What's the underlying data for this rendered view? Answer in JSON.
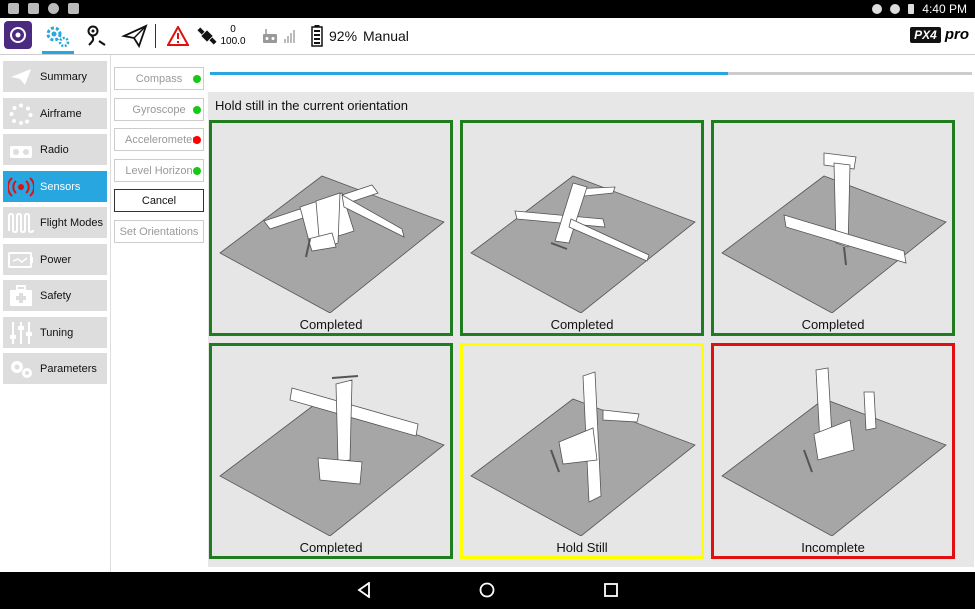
{
  "statusbar": {
    "time": "4:40 PM"
  },
  "toolbar": {
    "gps_count": "0",
    "gps_hdop": "100.0",
    "battery": "92%",
    "flight_mode": "Manual",
    "brand_badge": "PX4",
    "brand_text": "pro"
  },
  "sidebar": {
    "items": [
      {
        "label": "Summary"
      },
      {
        "label": "Airframe"
      },
      {
        "label": "Radio"
      },
      {
        "label": "Sensors"
      },
      {
        "label": "Flight Modes"
      },
      {
        "label": "Power"
      },
      {
        "label": "Safety"
      },
      {
        "label": "Tuning"
      },
      {
        "label": "Parameters"
      }
    ],
    "active_index": 3
  },
  "sensor_buttons": [
    {
      "label": "Compass",
      "status": "ok"
    },
    {
      "label": "Gyroscope",
      "status": "ok"
    },
    {
      "label": "Accelerometer",
      "status": "error"
    },
    {
      "label": "Level Horizon",
      "status": "ok"
    }
  ],
  "actions": {
    "cancel": "Cancel",
    "set_orientations": "Set Orientations"
  },
  "calibration": {
    "progress": 0.68,
    "instruction": "Hold still in the current orientation",
    "tiles": [
      {
        "label": "Completed",
        "state": "completed"
      },
      {
        "label": "Completed",
        "state": "completed"
      },
      {
        "label": "Completed",
        "state": "completed"
      },
      {
        "label": "Completed",
        "state": "completed"
      },
      {
        "label": "Hold Still",
        "state": "active"
      },
      {
        "label": "Incomplete",
        "state": "incomplete"
      }
    ]
  },
  "colors": {
    "accent": "#27a6e0",
    "ok": "#17c817",
    "error": "#ff0000",
    "completed": "#1f7d1f",
    "active": "#ffff00",
    "incomplete": "#e01010"
  }
}
